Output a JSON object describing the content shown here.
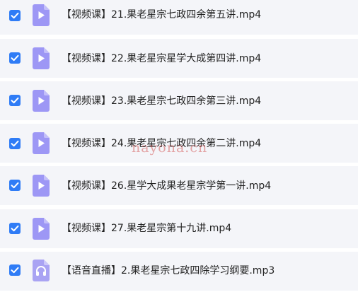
{
  "files": [
    {
      "name": "【视频课】21.果老星宗七政四余第五讲.mp4",
      "type": "video",
      "checked": true
    },
    {
      "name": "【视频课】22.果老星宗星学大成第四讲.mp4",
      "type": "video",
      "checked": true
    },
    {
      "name": "【视频课】23.果老星宗七政四余第三讲.mp4",
      "type": "video",
      "checked": true
    },
    {
      "name": "【视频课】24.果老星宗七政四余第二讲.mp4",
      "type": "video",
      "checked": true
    },
    {
      "name": "【视频课】26.星学大成果老星宗学第一讲.mp4",
      "type": "video",
      "checked": true
    },
    {
      "name": "【视频课】27.果老星宗第十九讲.mp4",
      "type": "video",
      "checked": true
    },
    {
      "name": "【语音直播】2.果老星宗七政四除学习纲要.mp3",
      "type": "audio",
      "checked": true
    }
  ],
  "watermark": "nayona.cn",
  "colors": {
    "checkbox": "#2f7cf6",
    "video_icon": "#9d97f5",
    "audio_icon": "#a9a3f3",
    "row_background": "#f4f5f9"
  },
  "icons": {
    "video": "video-file-icon",
    "audio": "audio-file-icon",
    "check": "checkmark-icon"
  }
}
